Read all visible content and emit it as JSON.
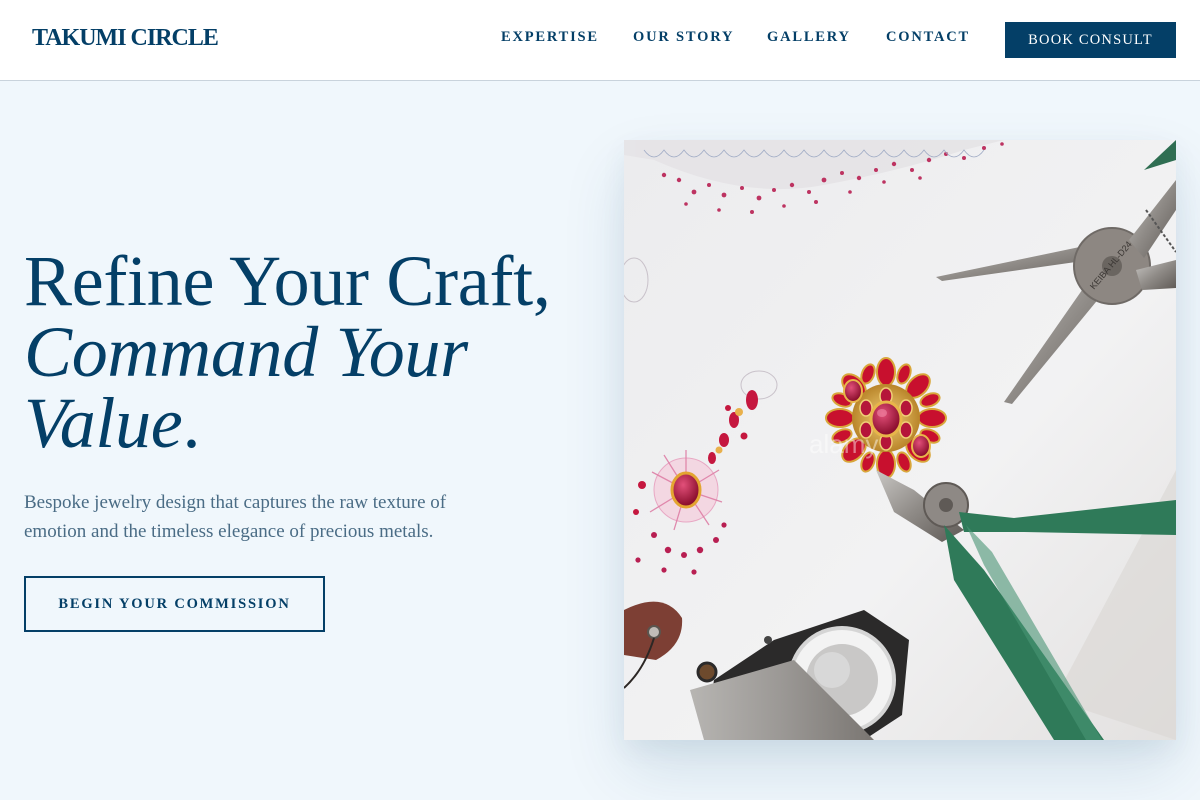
{
  "nav": {
    "logo": "TAKUMI CIRCLE",
    "links": [
      "EXPERTISE",
      "OUR STORY",
      "GALLERY",
      "CONTACT"
    ],
    "cta": "BOOK CONSULT"
  },
  "hero": {
    "headline_line1": "Refine Your Craft,",
    "headline_line2": "Command Your",
    "headline_line3_italic": "Value",
    "headline_line3_end": ".",
    "subtitle": "Bespoke jewelry design that captures the raw texture of emotion and the timeless elegance of precious metals.",
    "cta": "BEGIN YOUR COMMISSION",
    "image_watermark": "alamy"
  },
  "colors": {
    "navy": "#043f67",
    "background": "#f0f7fc",
    "muted_text": "#4a6c85"
  }
}
